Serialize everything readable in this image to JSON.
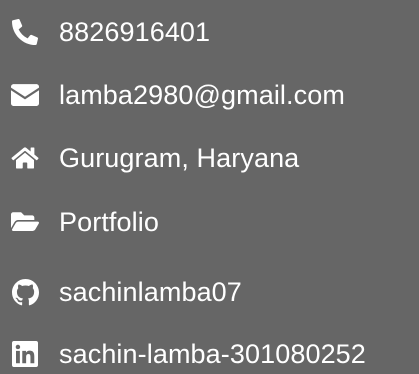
{
  "contact": {
    "phone": {
      "icon": "phone-icon",
      "label": "8826916401"
    },
    "email": {
      "icon": "envelope-icon",
      "label": "lamba2980@gmail.com"
    },
    "location": {
      "icon": "home-icon",
      "label": "Gurugram, Haryana"
    },
    "portfolio": {
      "icon": "folder-open-icon",
      "label": "Portfolio"
    },
    "github": {
      "icon": "github-icon",
      "label": "sachinlamba07"
    },
    "linkedin": {
      "icon": "linkedin-icon",
      "label": "sachin-lamba-301080252"
    }
  },
  "colors": {
    "background": "#666666",
    "text": "#ffffff"
  }
}
